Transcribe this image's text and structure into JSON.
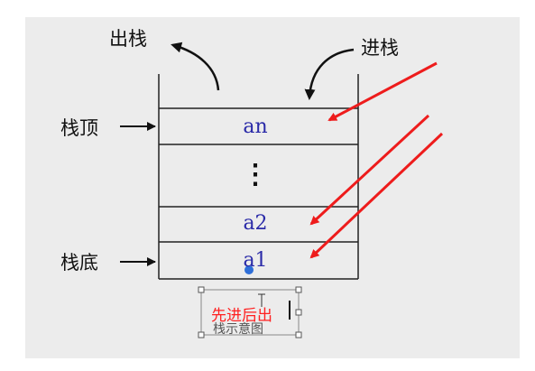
{
  "labels": {
    "pop": "出栈",
    "push": "进栈",
    "top": "栈顶",
    "bottom": "栈底"
  },
  "cells": [
    {
      "text": "an"
    },
    {
      "text": "⋮"
    },
    {
      "text": "a2"
    },
    {
      "text": "a1"
    }
  ],
  "caption": {
    "main": "先进后出",
    "sub": "栈示意图"
  },
  "colors": {
    "arrow_red": "#ee1c1c",
    "cell_text": "#2a2aa8",
    "dot": "#2f6fd8"
  }
}
